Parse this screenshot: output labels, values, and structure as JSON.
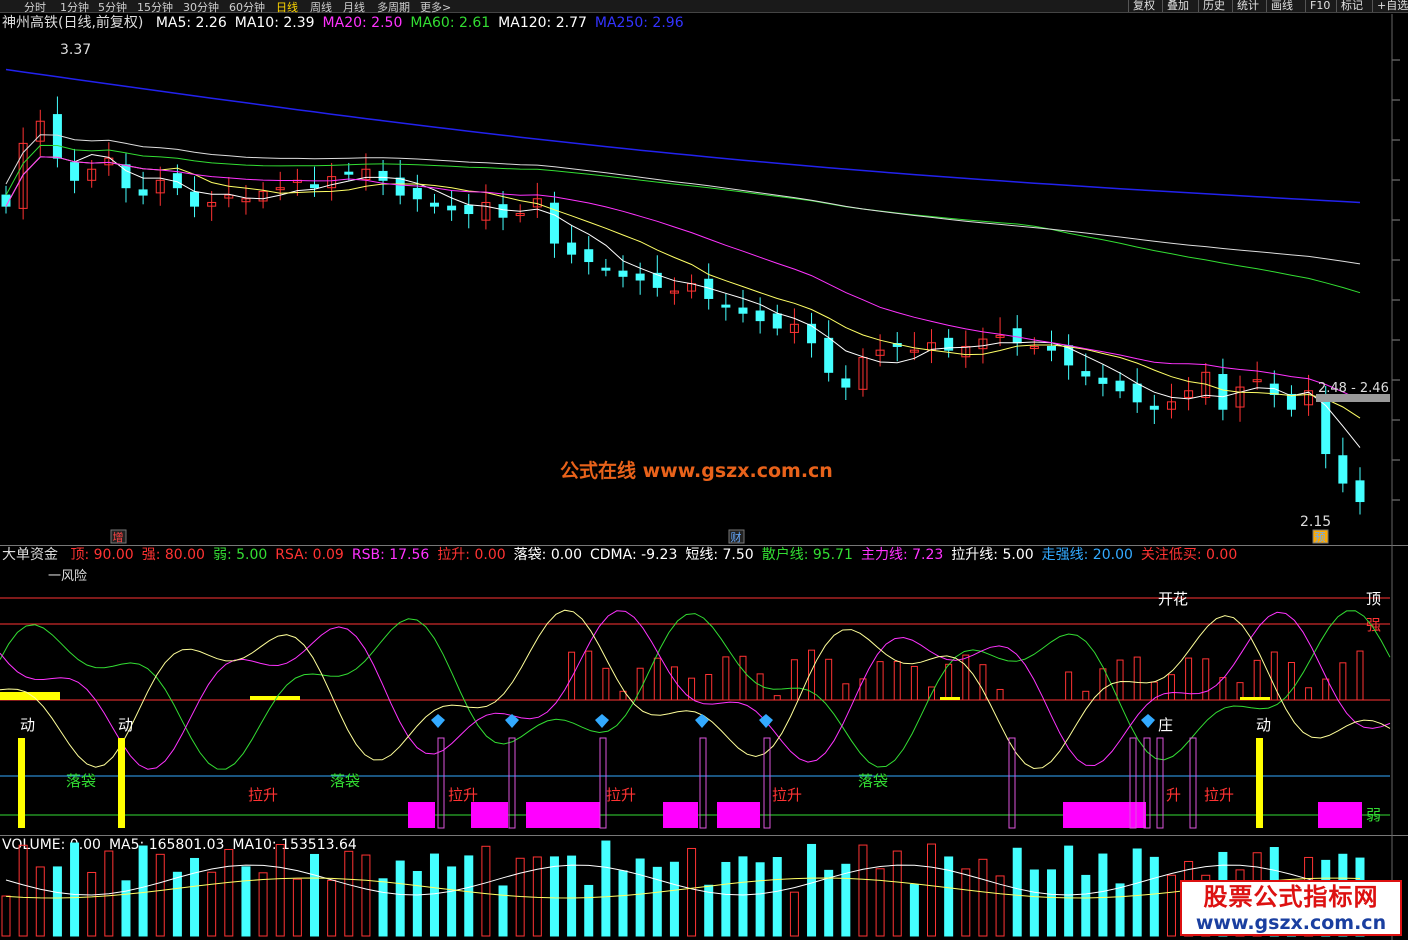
{
  "toolbar": {
    "periods": [
      "分时",
      "1分钟",
      "5分钟",
      "15分钟",
      "30分钟",
      "60分钟",
      "日线",
      "周线",
      "月线",
      "多周期",
      "更多>"
    ],
    "active_period": "日线",
    "buttons": [
      "复权",
      "叠加",
      "历史",
      "统计",
      "画线",
      "F10",
      "标记",
      "+自选"
    ]
  },
  "main_panel": {
    "title": "神州高铁(日线,前复权)",
    "ma_labels": [
      {
        "text": "MA5: 2.26",
        "color": "#ffffff"
      },
      {
        "text": "MA10: 2.39",
        "color": "#ffffff"
      },
      {
        "text": "MA20: 2.50",
        "color": "#ff33ff"
      },
      {
        "text": "MA60: 2.61",
        "color": "#33dd33"
      },
      {
        "text": "MA120: 2.77",
        "color": "#ffffff"
      },
      {
        "text": "MA250: 2.96",
        "color": "#3333ff"
      }
    ],
    "high_label": "3.37",
    "low_label": "2.15",
    "price_tag": "2.48 - 2.46",
    "event_markers": [
      "增",
      "财",
      "预"
    ],
    "watermark": "公式在线  www.gszx.com.cn"
  },
  "indicator_panel": {
    "title": "大单资金",
    "labels": [
      {
        "text": "顶: 90.00",
        "color": "#ff3333"
      },
      {
        "text": "强: 80.00",
        "color": "#ff3333"
      },
      {
        "text": "弱: 5.00",
        "color": "#33dd33"
      },
      {
        "text": "RSA: 0.09",
        "color": "#ff3333"
      },
      {
        "text": "RSB: 17.56",
        "color": "#ff33ff"
      },
      {
        "text": "拉升: 0.00",
        "color": "#ff3333"
      },
      {
        "text": "落袋: 0.00",
        "color": "#ffffff"
      },
      {
        "text": "CDMA: -9.23",
        "color": "#ffffff"
      },
      {
        "text": "短线: 7.50",
        "color": "#ffffff"
      },
      {
        "text": "散户线: 95.71",
        "color": "#33dd33"
      },
      {
        "text": "主力线: 7.23",
        "color": "#ff33ff"
      },
      {
        "text": "拉升线: 5.00",
        "color": "#ffffff"
      },
      {
        "text": "走强线: 20.00",
        "color": "#33aaff"
      },
      {
        "text": "关注低买: 0.00",
        "color": "#ff3333"
      }
    ],
    "risk_label": "一风险",
    "right_labels": [
      "顶",
      "强",
      "弱"
    ],
    "annotations": [
      {
        "text": "动",
        "color": "#ffffff"
      },
      {
        "text": "动",
        "color": "#ffffff"
      },
      {
        "text": "落袋",
        "color": "#33dd33"
      },
      {
        "text": "拉升",
        "color": "#ff3333"
      },
      {
        "text": "落袋",
        "color": "#33dd33"
      },
      {
        "text": "拉升",
        "color": "#ff3333"
      },
      {
        "text": "拉升",
        "color": "#ff3333"
      },
      {
        "text": "拉升",
        "color": "#ff3333"
      },
      {
        "text": "落袋",
        "color": "#33dd33"
      },
      {
        "text": "开花",
        "color": "#ffffff"
      },
      {
        "text": "庄",
        "color": "#ffffff"
      },
      {
        "text": "升",
        "color": "#ff3333"
      },
      {
        "text": "拉升",
        "color": "#ff3333"
      },
      {
        "text": "动",
        "color": "#ffffff"
      }
    ]
  },
  "volume_panel": {
    "labels": [
      {
        "text": "VOLUME: 0.00",
        "color": "#ffffff"
      },
      {
        "text": "MA5: 165801.03",
        "color": "#ffffff"
      },
      {
        "text": "MA10: 153513.64",
        "color": "#ffffff"
      }
    ]
  },
  "logo": {
    "line1": "股票公式指标网",
    "line2": "www.gszx.com.cn"
  },
  "colors": {
    "up": "#ff3333",
    "down": "#44ffff",
    "ma5": "#ffffff",
    "ma10": "#ffff66",
    "ma20": "#ff33ff",
    "ma60": "#33dd33",
    "ma120": "#dddddd",
    "ma250": "#2222ee"
  },
  "chart_data": {
    "type": "candlestick",
    "title": "神州高铁(日线,前复权)",
    "ylim": [
      2.1,
      3.4
    ],
    "close": [
      2.95,
      3.12,
      3.18,
      3.08,
      3.02,
      3.05,
      3.08,
      3.0,
      2.98,
      3.02,
      3.0,
      2.95,
      2.96,
      2.98,
      2.97,
      2.99,
      3.0,
      3.02,
      3.0,
      3.03,
      3.04,
      3.05,
      3.02,
      2.98,
      2.97,
      2.95,
      2.94,
      2.93,
      2.96,
      2.92,
      2.93,
      2.97,
      2.85,
      2.82,
      2.8,
      2.78,
      2.76,
      2.75,
      2.73,
      2.72,
      2.74,
      2.7,
      2.68,
      2.66,
      2.64,
      2.62,
      2.63,
      2.58,
      2.5,
      2.46,
      2.54,
      2.56,
      2.57,
      2.56,
      2.58,
      2.56,
      2.57,
      2.59,
      2.6,
      2.58,
      2.57,
      2.56,
      2.52,
      2.49,
      2.47,
      2.45,
      2.42,
      2.4,
      2.42,
      2.45,
      2.5,
      2.4,
      2.46,
      2.48,
      2.44,
      2.4,
      2.45,
      2.28,
      2.2,
      2.15
    ],
    "ma250_first": 3.32,
    "ma250_last": 2.96
  }
}
